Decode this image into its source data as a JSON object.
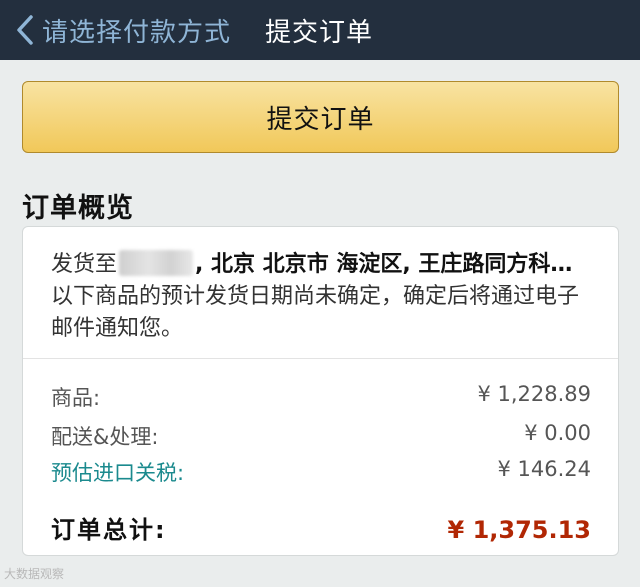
{
  "navbar": {
    "back_label": "请选择付款方式",
    "title": "提交订单",
    "back_icon": "chevron-left-icon"
  },
  "submit_button": {
    "label": "提交订单"
  },
  "summary": {
    "title": "订单概览",
    "ship_to_prefix": "发货至",
    "ship_to_address": ", 北京 北京市 海淀区, 王庄路同方科…",
    "ship_note": "以下商品的预计发货日期尚未确定，确定后将通过电子邮件通知您。",
    "rows": [
      {
        "label": "商品:",
        "value": "¥ 1,228.89"
      },
      {
        "label": "配送&处理:",
        "value": "¥ 0.00"
      },
      {
        "label": "预估进口关税:",
        "value": "¥ 146.24"
      }
    ],
    "total": {
      "label": "订单总计:",
      "value": "¥ 1,375.13"
    }
  },
  "watermark": "大数据观察",
  "colors": {
    "navbar_bg": "#232f3e",
    "button_yellow": "#f1c859",
    "total_red": "#b12704",
    "duty_link": "#1b8a8e"
  }
}
